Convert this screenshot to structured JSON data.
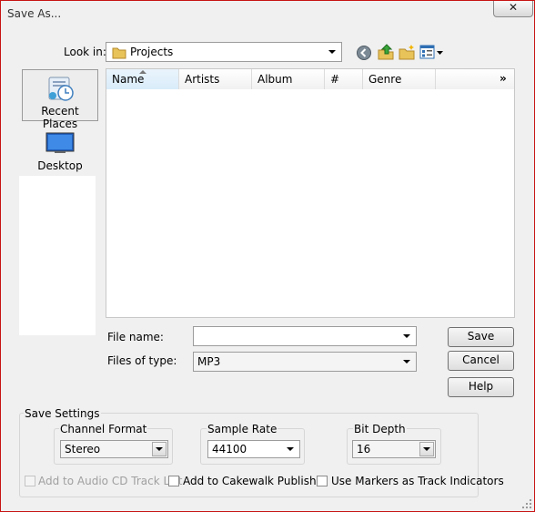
{
  "window": {
    "title": "Save As...",
    "close_label": "✕"
  },
  "lookin": {
    "label": "Look in:",
    "value": "Projects"
  },
  "toolbar": {
    "icons": [
      "back-icon",
      "up-folder-icon",
      "new-folder-icon",
      "view-menu-icon"
    ]
  },
  "places": [
    {
      "label": "Recent Places",
      "icon": "recent-places-icon"
    },
    {
      "label": "Desktop",
      "icon": "desktop-icon"
    }
  ],
  "filelist": {
    "columns": [
      "Name",
      "Artists",
      "Album",
      "#",
      "Genre"
    ],
    "more": "»"
  },
  "filename": {
    "label": "File name:",
    "value": ""
  },
  "filetype": {
    "label": "Files of type:",
    "value": "MP3"
  },
  "buttons": {
    "save": "Save",
    "cancel": "Cancel",
    "help": "Help"
  },
  "settings": {
    "title": "Save Settings",
    "channel": {
      "label": "Channel Format",
      "value": "Stereo"
    },
    "rate": {
      "label": "Sample Rate",
      "value": "44100"
    },
    "depth": {
      "label": "Bit Depth",
      "value": "16"
    },
    "cd_track": "Add to Audio CD Track List",
    "publisher": "Add to Cakewalk Publisher",
    "markers": "Use Markers as Track Indicators"
  }
}
